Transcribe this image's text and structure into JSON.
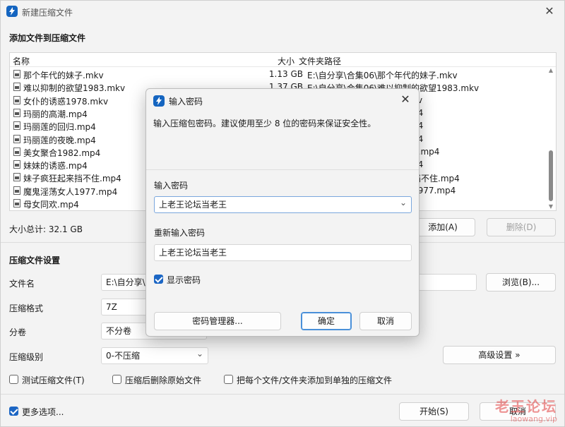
{
  "window": {
    "title": "新建压缩文件",
    "close_glyph": "✕",
    "icon": "winrar-icon"
  },
  "add_section": {
    "heading": "添加文件到压缩文件",
    "columns": {
      "name": "名称",
      "size": "大小",
      "path": "文件夹路径"
    },
    "files": [
      {
        "name": "那个年代的妹子.mkv",
        "size": "1.13 GB",
        "path": "E:\\自分享\\合集06\\那个年代的妹子.mkv"
      },
      {
        "name": "难以抑制的欲望1983.mkv",
        "size": "1.37 GB",
        "path": "E:\\自分享\\合集06\\难以抑制的欲望1983.mkv"
      },
      {
        "name": "女仆的诱惑1978.mkv",
        "size": "",
        "path": "kv"
      },
      {
        "name": "玛丽的高潮.mp4",
        "size": "",
        "path": "p4"
      },
      {
        "name": "玛丽莲的回归.mp4",
        "size": "",
        "path": "p4"
      },
      {
        "name": "玛丽莲的夜晚.mp4",
        "size": "",
        "path": "p4"
      },
      {
        "name": "美女聚合1982.mp4",
        "size": "",
        "path": "2.mp4"
      },
      {
        "name": "妹妹的诱惑.mp4",
        "size": "",
        "path": "p4"
      },
      {
        "name": "妹子疯狂起来挡不住.mp4",
        "size": "",
        "path": "挡不住.mp4"
      },
      {
        "name": "魔鬼淫荡女人1977.mp4",
        "size": "",
        "path": "1977.mp4"
      },
      {
        "name": "母女同欢.mp4",
        "size": "",
        "path": ""
      }
    ],
    "total_label": "大小总计: 32.1 GB",
    "add_button": "添加(A)",
    "delete_button": "删除(D)"
  },
  "settings": {
    "heading": "压缩文件设置",
    "filename_label": "文件名",
    "filename_value": "E:\\自分享\\",
    "browse_button": "浏览(B)...",
    "format_label": "压缩格式",
    "format_value": "7Z",
    "split_label": "分卷",
    "split_value": "不分卷",
    "level_label": "压缩级别",
    "level_value": "0-不压缩",
    "advanced_button": "高级设置 »",
    "test_label": "测试压缩文件(T)",
    "delete_after_label": "压缩后删除原始文件",
    "separate_label": "把每个文件/文件夹添加到单独的压缩文件",
    "more_options_label": "更多选项...",
    "start_button": "开始(S)",
    "cancel_button": "取消"
  },
  "dialog": {
    "title": "输入密码",
    "close_glyph": "✕",
    "description": "输入压缩包密码。建议使用至少 8 位的密码来保证安全性。",
    "password_label": "输入密码",
    "password_value": "上老王论坛当老王",
    "confirm_label": "重新输入密码",
    "confirm_value": "上老王论坛当老王",
    "show_password_label": "显示密码",
    "manager_button": "密码管理器...",
    "ok_button": "确定",
    "cancel_button": "取消"
  },
  "watermark": {
    "big": "老王论坛",
    "small": "laowang.vip"
  },
  "colors": {
    "accent": "#1c66c4",
    "watermark": "#e04040"
  }
}
